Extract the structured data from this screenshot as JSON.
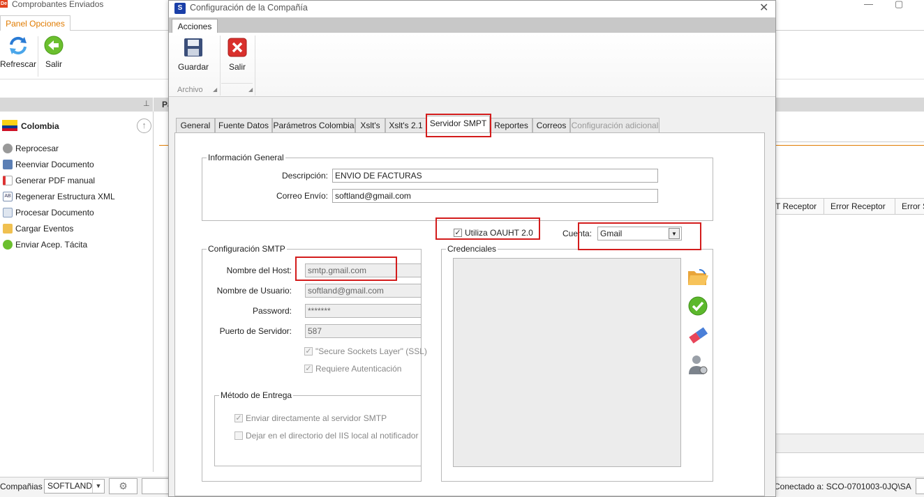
{
  "background_window": {
    "title": "Comprobantes Enviados",
    "ribbon_tab": "Panel Opciones",
    "ribbon_buttons": {
      "refresh": "Refrescar",
      "exit": "Salir"
    },
    "country": "Colombia",
    "nav_items": [
      {
        "label": "Reprocesar",
        "icon": "gear-icon"
      },
      {
        "label": "Reenviar Documento",
        "icon": "mail-icon"
      },
      {
        "label": "Generar PDF manual",
        "icon": "pdf-icon"
      },
      {
        "label": "Regenerar Estructura XML",
        "icon": "xml-icon"
      },
      {
        "label": "Procesar Documento",
        "icon": "document-icon"
      },
      {
        "label": "Cargar Eventos",
        "icon": "folder-icon"
      },
      {
        "label": "Enviar Acep. Tácita",
        "icon": "check-icon"
      }
    ],
    "column_headers": [
      "T Receptor",
      "Error Receptor",
      "Error S"
    ],
    "statusbar": {
      "company_label": "Compañias",
      "company_value": "SOFTLAND",
      "connection": "Conectado a: SCO-0701003-0JQ\\SA"
    }
  },
  "dialog": {
    "title": "Configuración de la Compañía",
    "ribbon_tab": "Acciones",
    "buttons": {
      "save": "Guardar",
      "exit": "Salir"
    },
    "group_label": "Archivo",
    "tabs": [
      "General",
      "Fuente Datos",
      "Parámetros Colombia",
      "Xslt's",
      "Xslt's 2.1",
      "Servidor SMPT",
      "Reportes",
      "Correos",
      "Configuración adicional"
    ],
    "active_tab": "Servidor SMPT",
    "general_info": {
      "legend": "Información General",
      "description_label": "Descripción:",
      "description_value": "ENVIO DE FACTURAS",
      "email_label": "Correo Envío:",
      "email_value": "softland@gmail.com"
    },
    "oauth": {
      "label": "Utiliza OAUHT 2.0",
      "checked": true,
      "account_label": "Cuenta:",
      "account_value": "Gmail"
    },
    "smtp": {
      "legend": "Configuración SMTP",
      "host_label": "Nombre del Host:",
      "host_value": "smtp.gmail.com",
      "user_label": "Nombre de Usuario:",
      "user_value": "softland@gmail.com",
      "password_label": "Password:",
      "password_value": "*******",
      "port_label": "Puerto de Servidor:",
      "port_value": "587",
      "ssl_label": "\"Secure Sockets Layer\" (SSL)",
      "auth_label": "Requiere Autenticación"
    },
    "delivery": {
      "legend": "Método de Entrega",
      "option1": "Enviar directamente al servidor SMTP",
      "option2": "Dejar en el directorio del IIS local al notificador"
    },
    "credentials": {
      "legend": "Credenciales"
    },
    "colors": {
      "highlight": "#d31c1c",
      "accent": "#e07b00"
    }
  }
}
